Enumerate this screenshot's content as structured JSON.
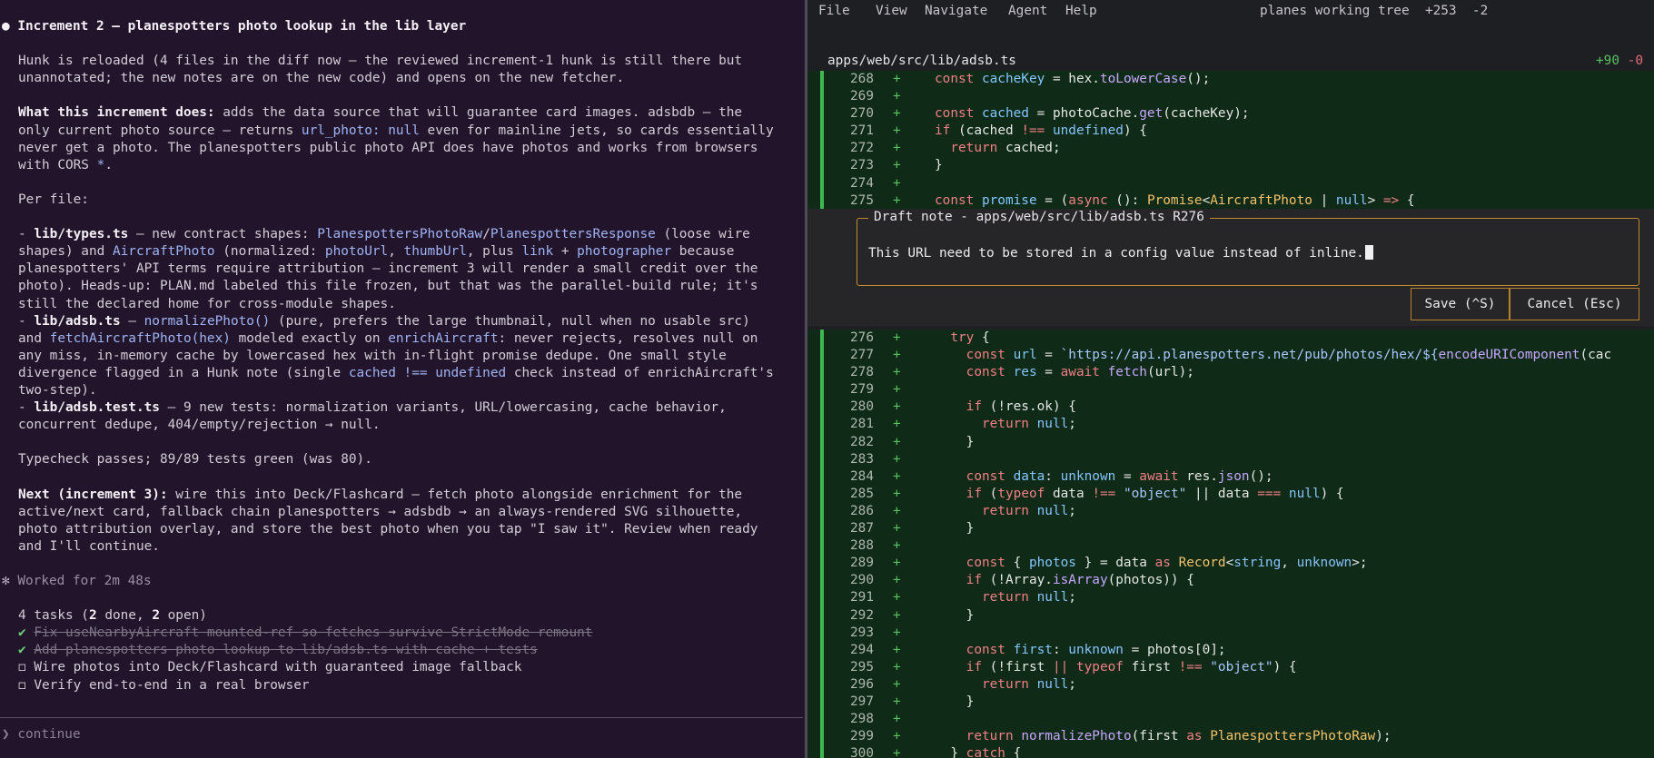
{
  "left_pane": {
    "lines": [
      {
        "kind": "head",
        "segs": [
          {
            "t": "● Increment 2 — planespotters photo lookup in the lib layer"
          }
        ]
      },
      {
        "segs": [
          {
            "t": ""
          }
        ]
      },
      {
        "segs": [
          {
            "t": "Hunk is reloaded (4 files in the diff now — the reviewed increment-1 hunk is still there but"
          }
        ]
      },
      {
        "segs": [
          {
            "t": "unannotated; the new notes are on the new code) and opens on the new fetcher."
          }
        ]
      },
      {
        "segs": [
          {
            "t": ""
          }
        ]
      },
      {
        "segs": [
          {
            "t": "What this increment does:",
            "s": "b"
          },
          {
            "t": " adds the data source that will guarantee card images. adsbdb — the"
          }
        ]
      },
      {
        "segs": [
          {
            "t": "only current photo source — returns "
          },
          {
            "t": "url_photo: null",
            "s": "c"
          },
          {
            "t": " even for mainline jets, so cards essentially"
          }
        ]
      },
      {
        "segs": [
          {
            "t": "never get a photo. The planespotters public photo API does have photos and works from browsers"
          }
        ]
      },
      {
        "segs": [
          {
            "t": "with CORS "
          },
          {
            "t": "*",
            "s": "c"
          },
          {
            "t": "."
          }
        ]
      },
      {
        "segs": [
          {
            "t": ""
          }
        ]
      },
      {
        "segs": [
          {
            "t": "Per file:"
          }
        ]
      },
      {
        "segs": [
          {
            "t": ""
          }
        ]
      },
      {
        "segs": [
          {
            "t": "- "
          },
          {
            "t": "lib/types.ts",
            "s": "b"
          },
          {
            "t": " — new contract shapes: "
          },
          {
            "t": "PlanespottersPhotoRaw",
            "s": "c"
          },
          {
            "t": "/"
          },
          {
            "t": "PlanespottersResponse",
            "s": "c"
          },
          {
            "t": " (loose wire"
          }
        ]
      },
      {
        "segs": [
          {
            "t": "shapes) and "
          },
          {
            "t": "AircraftPhoto",
            "s": "c"
          },
          {
            "t": " (normalized: "
          },
          {
            "t": "photoUrl",
            "s": "c"
          },
          {
            "t": ", "
          },
          {
            "t": "thumbUrl",
            "s": "c"
          },
          {
            "t": ", plus "
          },
          {
            "t": "link",
            "s": "c"
          },
          {
            "t": " + "
          },
          {
            "t": "photographer",
            "s": "c"
          },
          {
            "t": " because"
          }
        ]
      },
      {
        "segs": [
          {
            "t": "planespotters' API terms require attribution — increment 3 will render a small credit over the"
          }
        ]
      },
      {
        "segs": [
          {
            "t": "photo). Heads-up: PLAN.md labeled this file frozen, but that was the parallel-build rule; it's"
          }
        ]
      },
      {
        "segs": [
          {
            "t": "still the declared home for cross-module shapes."
          }
        ]
      },
      {
        "segs": [
          {
            "t": "- "
          },
          {
            "t": "lib/adsb.ts",
            "s": "b"
          },
          {
            "t": " — "
          },
          {
            "t": "normalizePhoto()",
            "s": "c"
          },
          {
            "t": " (pure, prefers the large thumbnail, null when no usable src)"
          }
        ]
      },
      {
        "segs": [
          {
            "t": "and "
          },
          {
            "t": "fetchAircraftPhoto(hex)",
            "s": "c"
          },
          {
            "t": " modeled exactly on "
          },
          {
            "t": "enrichAircraft",
            "s": "c"
          },
          {
            "t": ": never rejects, resolves null on"
          }
        ]
      },
      {
        "segs": [
          {
            "t": "any miss, in-memory cache by lowercased hex with in-flight promise dedupe. One small style"
          }
        ]
      },
      {
        "segs": [
          {
            "t": "divergence flagged in a Hunk note (single "
          },
          {
            "t": "cached !== undefined",
            "s": "c"
          },
          {
            "t": " check instead of enrichAircraft's"
          }
        ]
      },
      {
        "segs": [
          {
            "t": "two-step)."
          }
        ]
      },
      {
        "segs": [
          {
            "t": "- "
          },
          {
            "t": "lib/adsb.test.ts",
            "s": "b"
          },
          {
            "t": " — 9 new tests: normalization variants, URL/lowercasing, cache behavior,"
          }
        ]
      },
      {
        "segs": [
          {
            "t": "concurrent dedupe, 404/empty/rejection → null."
          }
        ]
      },
      {
        "segs": [
          {
            "t": ""
          }
        ]
      },
      {
        "segs": [
          {
            "t": "Typecheck passes; 89/89 tests green (was 80)."
          }
        ]
      },
      {
        "segs": [
          {
            "t": ""
          }
        ]
      },
      {
        "segs": [
          {
            "t": "Next (increment 3):",
            "s": "b"
          },
          {
            "t": " wire this into Deck/Flashcard — fetch photo alongside enrichment for the"
          }
        ]
      },
      {
        "segs": [
          {
            "t": "active/next card, fallback chain planespotters → adsbdb → an always-rendered SVG silhouette,"
          }
        ]
      },
      {
        "segs": [
          {
            "t": "photo attribution overlay, and store the best photo when you tap \"I saw it\". Review when ready"
          }
        ]
      },
      {
        "segs": [
          {
            "t": "and I'll continue."
          }
        ]
      },
      {
        "segs": [
          {
            "t": ""
          }
        ]
      },
      {
        "kind": "flush",
        "segs": [
          {
            "t": "✻ ",
            "s": "star"
          },
          {
            "t": "Worked for 2m 48s",
            "s": "dim"
          }
        ]
      },
      {
        "segs": [
          {
            "t": ""
          }
        ]
      },
      {
        "segs": [
          {
            "t": "4 tasks ("
          },
          {
            "t": "2",
            "s": "b"
          },
          {
            "t": " done, "
          },
          {
            "t": "2",
            "s": "b"
          },
          {
            "t": " open)"
          }
        ]
      },
      {
        "segs": [
          {
            "t": "✔ ",
            "s": "chk"
          },
          {
            "t": "Fix useNearbyAircraft mounted-ref so fetches survive StrictMode remount",
            "s": "done"
          }
        ]
      },
      {
        "segs": [
          {
            "t": "✔ ",
            "s": "chk"
          },
          {
            "t": "Add planespotters photo lookup to lib/adsb.ts with cache + tests",
            "s": "done"
          }
        ]
      },
      {
        "segs": [
          {
            "t": "◻ Wire photos into Deck/Flashcard with guaranteed image fallback"
          }
        ]
      },
      {
        "segs": [
          {
            "t": "◻ Verify end-to-end in a real browser"
          }
        ]
      }
    ],
    "prompt": "❯ continue"
  },
  "editor": {
    "menu": [
      "File",
      "View",
      "Navigate",
      "Agent",
      "Help"
    ],
    "title": "planes working tree  +253  -2",
    "file_path": "apps/web/src/lib/adsb.ts",
    "adds": "+90",
    "dels": "-0",
    "code_top": [
      {
        "n": "268",
        "segs": [
          {
            "t": "const ",
            "s": "kw"
          },
          {
            "t": "cacheKey",
            "s": "var"
          },
          {
            "t": " = hex."
          },
          {
            "t": "toLowerCase",
            "s": "fn"
          },
          {
            "t": "();"
          }
        ]
      },
      {
        "n": "269",
        "segs": []
      },
      {
        "n": "270",
        "segs": [
          {
            "t": "const ",
            "s": "kw"
          },
          {
            "t": "cached",
            "s": "var"
          },
          {
            "t": " = photoCache."
          },
          {
            "t": "get",
            "s": "fn"
          },
          {
            "t": "(cacheKey);"
          }
        ]
      },
      {
        "n": "271",
        "segs": [
          {
            "t": "if ",
            "s": "kw"
          },
          {
            "t": "(cached "
          },
          {
            "t": "!== ",
            "s": "kw"
          },
          {
            "t": "undefined",
            "s": "cst"
          },
          {
            "t": ") {"
          }
        ]
      },
      {
        "n": "272",
        "segs": [
          {
            "t": "  return ",
            "s": "kw"
          },
          {
            "t": "cached;"
          }
        ]
      },
      {
        "n": "273",
        "segs": [
          {
            "t": "}"
          }
        ]
      },
      {
        "n": "274",
        "segs": []
      },
      {
        "n": "275",
        "segs": [
          {
            "t": "const ",
            "s": "kw"
          },
          {
            "t": "promise",
            "s": "var"
          },
          {
            "t": " = ("
          },
          {
            "t": "async ",
            "s": "kw"
          },
          {
            "t": "(): "
          },
          {
            "t": "Promise",
            "s": "ty"
          },
          {
            "t": "<"
          },
          {
            "t": "AircraftPhoto",
            "s": "ty"
          },
          {
            "t": " | "
          },
          {
            "t": "null",
            "s": "cst"
          },
          {
            "t": "> "
          },
          {
            "t": "=> ",
            "s": "kw"
          },
          {
            "t": "{"
          }
        ]
      }
    ],
    "note": {
      "legend": "Draft note - apps/web/src/lib/adsb.ts R276",
      "text": "This URL need to be stored in a config value instead of inline.",
      "save": "Save (^S)",
      "cancel": "Cancel (Esc)"
    },
    "code_bottom": [
      {
        "n": "276",
        "segs": [
          {
            "t": "  try ",
            "s": "kw"
          },
          {
            "t": "{"
          }
        ]
      },
      {
        "n": "277",
        "segs": [
          {
            "t": "    const ",
            "s": "kw"
          },
          {
            "t": "url",
            "s": "var"
          },
          {
            "t": " = "
          },
          {
            "t": "`https://api.planespotters.net/pub/photos/hex/${",
            "s": "str"
          },
          {
            "t": "encodeURIComponent",
            "s": "fn"
          },
          {
            "t": "(cac"
          }
        ]
      },
      {
        "n": "278",
        "segs": [
          {
            "t": "    const ",
            "s": "kw"
          },
          {
            "t": "res",
            "s": "var"
          },
          {
            "t": " = "
          },
          {
            "t": "await ",
            "s": "kw"
          },
          {
            "t": "fetch",
            "s": "fn"
          },
          {
            "t": "(url);"
          }
        ]
      },
      {
        "n": "279",
        "segs": []
      },
      {
        "n": "280",
        "segs": [
          {
            "t": "    if ",
            "s": "kw"
          },
          {
            "t": "(!res.ok) {"
          }
        ]
      },
      {
        "n": "281",
        "segs": [
          {
            "t": "      return ",
            "s": "kw"
          },
          {
            "t": "null",
            "s": "cst"
          },
          {
            "t": ";"
          }
        ]
      },
      {
        "n": "282",
        "segs": [
          {
            "t": "    }"
          }
        ]
      },
      {
        "n": "283",
        "segs": []
      },
      {
        "n": "284",
        "segs": [
          {
            "t": "    const ",
            "s": "kw"
          },
          {
            "t": "data",
            "s": "var"
          },
          {
            "t": ": "
          },
          {
            "t": "unknown",
            "s": "cst"
          },
          {
            "t": " = "
          },
          {
            "t": "await ",
            "s": "kw"
          },
          {
            "t": "res."
          },
          {
            "t": "json",
            "s": "fn"
          },
          {
            "t": "();"
          }
        ]
      },
      {
        "n": "285",
        "segs": [
          {
            "t": "    if ",
            "s": "kw"
          },
          {
            "t": "("
          },
          {
            "t": "typeof ",
            "s": "kw"
          },
          {
            "t": "data "
          },
          {
            "t": "!== ",
            "s": "kw"
          },
          {
            "t": "\"object\"",
            "s": "str"
          },
          {
            "t": " || data "
          },
          {
            "t": "=== ",
            "s": "kw"
          },
          {
            "t": "null",
            "s": "cst"
          },
          {
            "t": ") {"
          }
        ]
      },
      {
        "n": "286",
        "segs": [
          {
            "t": "      return ",
            "s": "kw"
          },
          {
            "t": "null",
            "s": "cst"
          },
          {
            "t": ";"
          }
        ]
      },
      {
        "n": "287",
        "segs": [
          {
            "t": "    }"
          }
        ]
      },
      {
        "n": "288",
        "segs": []
      },
      {
        "n": "289",
        "segs": [
          {
            "t": "    const ",
            "s": "kw"
          },
          {
            "t": "{ "
          },
          {
            "t": "photos",
            "s": "var"
          },
          {
            "t": " } = data "
          },
          {
            "t": "as ",
            "s": "kw"
          },
          {
            "t": "Record",
            "s": "ty"
          },
          {
            "t": "<"
          },
          {
            "t": "string",
            "s": "cst"
          },
          {
            "t": ", "
          },
          {
            "t": "unknown",
            "s": "cst"
          },
          {
            "t": ">;"
          }
        ]
      },
      {
        "n": "290",
        "segs": [
          {
            "t": "    if ",
            "s": "kw"
          },
          {
            "t": "(!Array."
          },
          {
            "t": "isArray",
            "s": "fn"
          },
          {
            "t": "(photos)) {"
          }
        ]
      },
      {
        "n": "291",
        "segs": [
          {
            "t": "      return ",
            "s": "kw"
          },
          {
            "t": "null",
            "s": "cst"
          },
          {
            "t": ";"
          }
        ]
      },
      {
        "n": "292",
        "segs": [
          {
            "t": "    }"
          }
        ]
      },
      {
        "n": "293",
        "segs": []
      },
      {
        "n": "294",
        "segs": [
          {
            "t": "    const ",
            "s": "kw"
          },
          {
            "t": "first",
            "s": "var"
          },
          {
            "t": ": "
          },
          {
            "t": "unknown",
            "s": "cst"
          },
          {
            "t": " = photos[0];"
          }
        ]
      },
      {
        "n": "295",
        "segs": [
          {
            "t": "    if ",
            "s": "kw"
          },
          {
            "t": "(!first "
          },
          {
            "t": "|| typeof ",
            "s": "kw"
          },
          {
            "t": "first "
          },
          {
            "t": "!== ",
            "s": "kw"
          },
          {
            "t": "\"object\"",
            "s": "str"
          },
          {
            "t": ") {"
          }
        ]
      },
      {
        "n": "296",
        "segs": [
          {
            "t": "      return ",
            "s": "kw"
          },
          {
            "t": "null",
            "s": "cst"
          },
          {
            "t": ";"
          }
        ]
      },
      {
        "n": "297",
        "segs": [
          {
            "t": "    }"
          }
        ]
      },
      {
        "n": "298",
        "segs": []
      },
      {
        "n": "299",
        "segs": [
          {
            "t": "    return ",
            "s": "kw"
          },
          {
            "t": "normalizePhoto",
            "s": "fn"
          },
          {
            "t": "(first "
          },
          {
            "t": "as ",
            "s": "kw"
          },
          {
            "t": "PlanespottersPhotoRaw",
            "s": "ty"
          },
          {
            "t": ");"
          }
        ]
      },
      {
        "n": "300",
        "segs": [
          {
            "t": "  } "
          },
          {
            "t": "catch ",
            "s": "kw"
          },
          {
            "t": "{"
          }
        ]
      }
    ]
  }
}
